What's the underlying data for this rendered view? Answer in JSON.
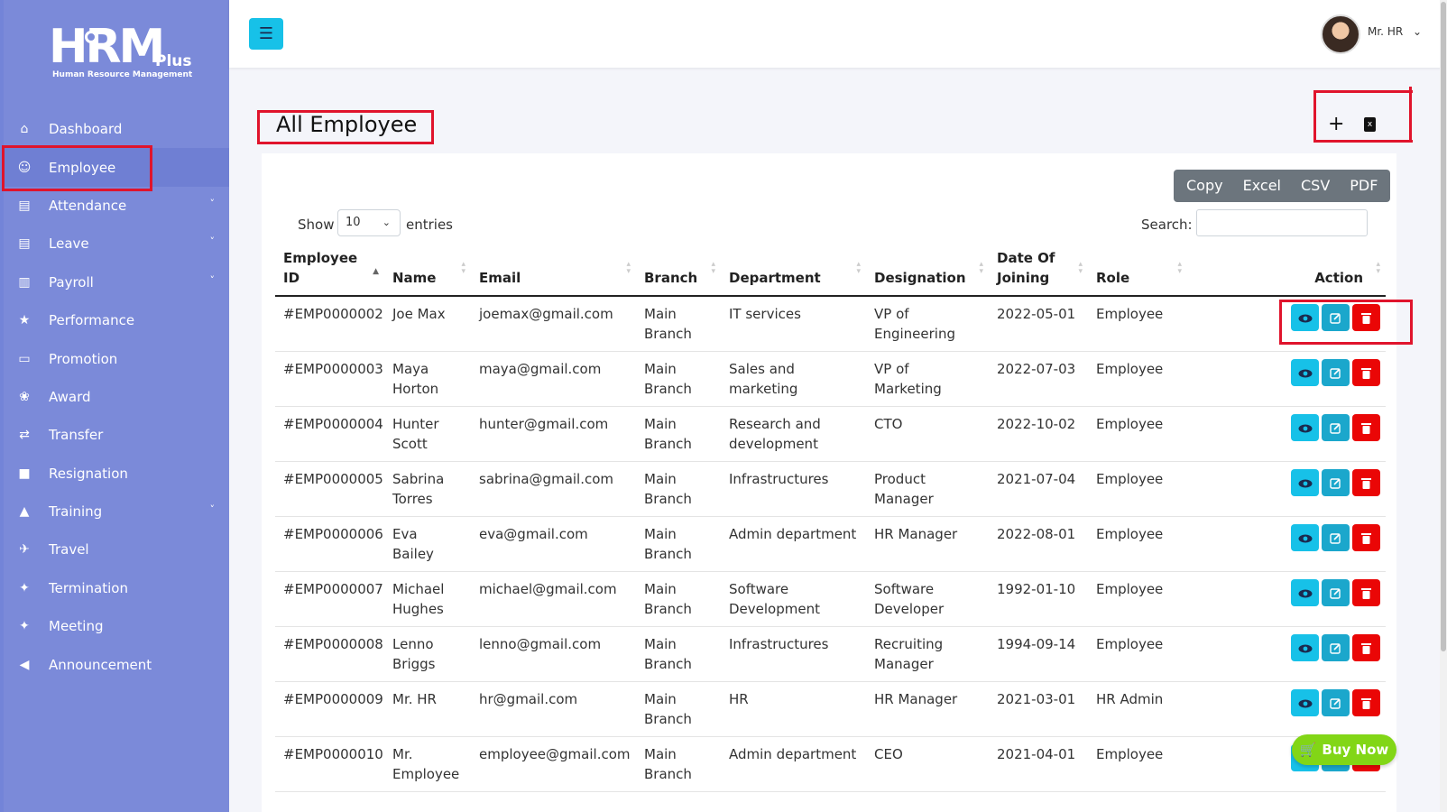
{
  "brand": {
    "logo_text": "HRM",
    "logo_plus": "Plus",
    "logo_sub": "Human Resource Management"
  },
  "sidebar": {
    "items": [
      {
        "label": "Dashboard",
        "icon": "home-icon",
        "chevron": false
      },
      {
        "label": "Employee",
        "icon": "users-icon",
        "chevron": false,
        "active": true
      },
      {
        "label": "Attendance",
        "icon": "clipboard-icon",
        "chevron": true
      },
      {
        "label": "Leave",
        "icon": "clipboard-icon",
        "chevron": true
      },
      {
        "label": "Payroll",
        "icon": "receipt-icon",
        "chevron": true
      },
      {
        "label": "Performance",
        "icon": "running-icon",
        "chevron": false
      },
      {
        "label": "Promotion",
        "icon": "presentation-icon",
        "chevron": false
      },
      {
        "label": "Award",
        "icon": "award-icon",
        "chevron": false
      },
      {
        "label": "Transfer",
        "icon": "transfer-icon",
        "chevron": false
      },
      {
        "label": "Resignation",
        "icon": "note-icon",
        "chevron": false
      },
      {
        "label": "Training",
        "icon": "graduation-cap-icon",
        "chevron": true
      },
      {
        "label": "Travel",
        "icon": "plane-icon",
        "chevron": false
      },
      {
        "label": "Termination",
        "icon": "walking-icon",
        "chevron": false
      },
      {
        "label": "Meeting",
        "icon": "handshake-icon",
        "chevron": false
      },
      {
        "label": "Announcement",
        "icon": "megaphone-icon",
        "chevron": false
      }
    ]
  },
  "header": {
    "user_name": "Mr. HR"
  },
  "page": {
    "title": "All Employee"
  },
  "toolbar": {
    "export_buttons": [
      "Copy",
      "Excel",
      "CSV",
      "PDF"
    ],
    "show_label": "Show",
    "length_value": "10",
    "entries_label": "entries",
    "search_label": "Search:"
  },
  "table": {
    "columns": [
      "Employee ID",
      "Name",
      "Email",
      "Branch",
      "Department",
      "Designation",
      "Date Of Joining",
      "Role",
      "Action"
    ],
    "rows": [
      {
        "id": "#EMP0000002",
        "name": "Joe Max",
        "email": "joemax@gmail.com",
        "branch": "Main Branch",
        "department": "IT services",
        "designation": "VP of Engineering",
        "doj": "2022-05-01",
        "role": "Employee"
      },
      {
        "id": "#EMP0000003",
        "name": "Maya Horton",
        "email": "maya@gmail.com",
        "branch": "Main Branch",
        "department": "Sales and marketing",
        "designation": "VP of Marketing",
        "doj": "2022-07-03",
        "role": "Employee"
      },
      {
        "id": "#EMP0000004",
        "name": "Hunter Scott",
        "email": "hunter@gmail.com",
        "branch": "Main Branch",
        "department": "Research and development",
        "designation": "CTO",
        "doj": "2022-10-02",
        "role": "Employee"
      },
      {
        "id": "#EMP0000005",
        "name": "Sabrina Torres",
        "email": "sabrina@gmail.com",
        "branch": "Main Branch",
        "department": "Infrastructures",
        "designation": "Product Manager",
        "doj": "2021-07-04",
        "role": "Employee"
      },
      {
        "id": "#EMP0000006",
        "name": "Eva Bailey",
        "email": "eva@gmail.com",
        "branch": "Main Branch",
        "department": "Admin department",
        "designation": "HR Manager",
        "doj": "2022-08-01",
        "role": "Employee"
      },
      {
        "id": "#EMP0000007",
        "name": "Michael Hughes",
        "email": "michael@gmail.com",
        "branch": "Main Branch",
        "department": "Software Development",
        "designation": "Software Developer",
        "doj": "1992-01-10",
        "role": "Employee"
      },
      {
        "id": "#EMP0000008",
        "name": "Lenno Briggs",
        "email": "lenno@gmail.com",
        "branch": "Main Branch",
        "department": "Infrastructures",
        "designation": "Recruiting Manager",
        "doj": "1994-09-14",
        "role": "Employee"
      },
      {
        "id": "#EMP0000009",
        "name": "Mr. HR",
        "email": "hr@gmail.com",
        "branch": "Main Branch",
        "department": "HR",
        "designation": "HR Manager",
        "doj": "2021-03-01",
        "role": "HR Admin"
      },
      {
        "id": "#EMP0000010",
        "name": "Mr. Employee",
        "email": "employee@gmail.com",
        "branch": "Main Branch",
        "department": "Admin department",
        "designation": "CEO",
        "doj": "2021-04-01",
        "role": "Employee"
      }
    ]
  },
  "cta": {
    "buy_now": "Buy Now"
  },
  "colors": {
    "sidebar": "#7b8ad9",
    "accent": "#17c1e8",
    "edit": "#1ba7cc",
    "delete": "#ea0606",
    "buy_now": "#82d616",
    "highlight": "#e0142c"
  }
}
